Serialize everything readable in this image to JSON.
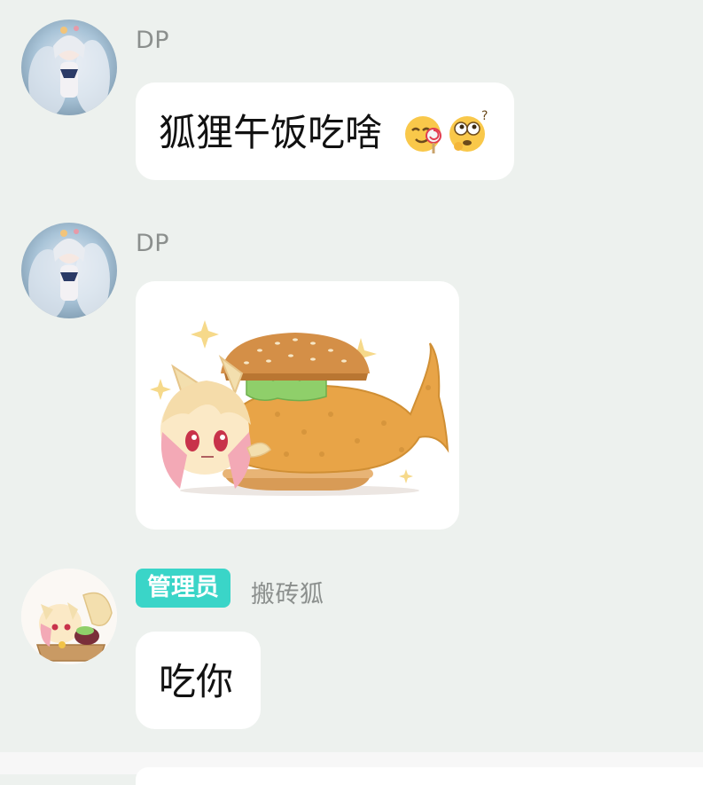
{
  "messages": [
    {
      "sender": "DP",
      "text": "狐狸午饭吃啥",
      "emojis": [
        "yum-lollipop-emoji",
        "thinking-rolling-eyes-emoji"
      ]
    },
    {
      "sender": "DP",
      "sticker": "fox-girl-fish-burger-sticker"
    },
    {
      "badge": "管理员",
      "sender": "搬砖狐",
      "text": "吃你"
    }
  ],
  "colors": {
    "background": "#edf1ee",
    "bubble": "#ffffff",
    "badge": "#3ad5c8",
    "sender": "#8b8f8d"
  }
}
